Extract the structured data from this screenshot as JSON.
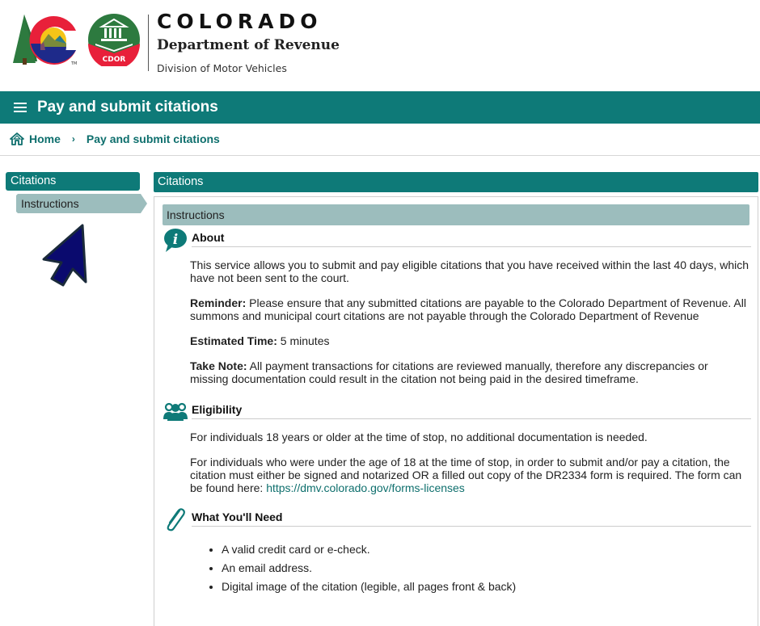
{
  "brand": {
    "state": "COLORADO",
    "department": "Department of Revenue",
    "division": "Division of Motor Vehicles",
    "cdor_badge": "CDOR",
    "tm": "TM"
  },
  "title_bar": {
    "menu_icon": "hamburger-menu-icon",
    "title": "Pay and submit citations"
  },
  "breadcrumb": {
    "home_icon": "home-icon",
    "home": "Home",
    "separator": "›",
    "current": "Pay and submit citations"
  },
  "sidebar": {
    "header": "Citations",
    "items": [
      {
        "label": "Instructions",
        "active": true
      }
    ]
  },
  "main": {
    "header": "Citations",
    "subheader": "Instructions",
    "sections": {
      "about": {
        "icon": "info-speech-bubble-icon",
        "title": "About",
        "intro": "This service allows you to submit and pay eligible citations that you have received within the last 40 days, which have not been sent to the court.",
        "reminder_label": "Reminder:",
        "reminder_text": " Please ensure that any submitted citations are payable to the Colorado Department of Revenue. All summons and municipal court citations are not payable through the Colorado Department of Revenue",
        "time_label": "Estimated Time:",
        "time_text": " 5 minutes",
        "note_label": "Take Note:",
        "note_text": " All payment transactions for citations are reviewed manually, therefore any discrepancies or missing documentation could result in the citation not being paid in the desired timeframe."
      },
      "eligibility": {
        "icon": "users-group-icon",
        "title": "Eligibility",
        "adult": "For individuals 18 years or older at the time of stop, no additional documentation is needed.",
        "minor_text": "For individuals who were under the age of 18 at the time of stop, in order to submit and/or pay a citation, the citation must either be signed and notarized OR a filled out copy of the DR2334 form is required. The form can be found here: ",
        "form_link": "https://dmv.colorado.gov/forms-licenses"
      },
      "needs": {
        "icon": "paperclip-icon",
        "title": "What You'll Need",
        "items": [
          "A valid credit card or e-check.",
          "An email address.",
          "Digital image of the citation (legible, all pages front & back)"
        ]
      }
    }
  },
  "colors": {
    "brand_teal": "#0e7a78",
    "sub_header": "#9cbdbd",
    "link": "#0e6f6d",
    "cursor": "#0a0a6e"
  }
}
